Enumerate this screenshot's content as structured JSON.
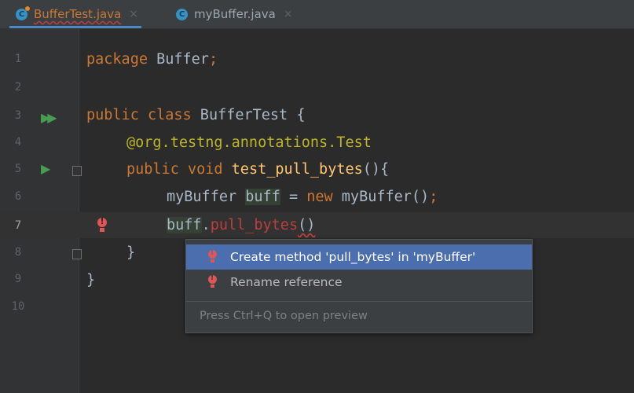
{
  "tabs": [
    {
      "label": "BufferTest.java",
      "icon": "java-class-error-icon",
      "active": true
    },
    {
      "label": "myBuffer.java",
      "icon": "java-class-icon",
      "active": false
    }
  ],
  "tab_close_glyph": "×",
  "line_numbers": [
    "1",
    "2",
    "3",
    "4",
    "5",
    "6",
    "7",
    "8",
    "9",
    "10"
  ],
  "current_line": "7",
  "code": {
    "l1": {
      "kw": "package",
      "rest": " Buffer",
      "semi": ";"
    },
    "l3": {
      "kw1": "public",
      "kw2": "class",
      "name": " BufferTest {"
    },
    "l4": {
      "ann": "@org.testng.annotations.Test"
    },
    "l5": {
      "kw1": "public",
      "kw2": "void",
      "method": "test_pull_bytes",
      "tail": "(){"
    },
    "l6": {
      "type": "myBuffer ",
      "var": "buff",
      "eq": " = ",
      "kw": "new",
      "call": " myBuffer()",
      "semi": ";"
    },
    "l7": {
      "var": "buff",
      "dot": ".",
      "method": "pull_bytes",
      "parens": "()"
    },
    "l8": {
      "brace": "}"
    },
    "l9": {
      "brace": "}"
    }
  },
  "popup": {
    "items": [
      {
        "label": "Create method 'pull_bytes' in 'myBuffer'",
        "selected": true
      },
      {
        "label": "Rename reference",
        "selected": false
      }
    ],
    "hint": "Press Ctrl+Q to open preview"
  },
  "colors": {
    "background": "#2b2b2b",
    "keyword": "#cc7832",
    "annotation": "#bbb529",
    "method_decl": "#ffc66d",
    "error": "#bc3f3c",
    "selection": "#4b6eaf"
  }
}
